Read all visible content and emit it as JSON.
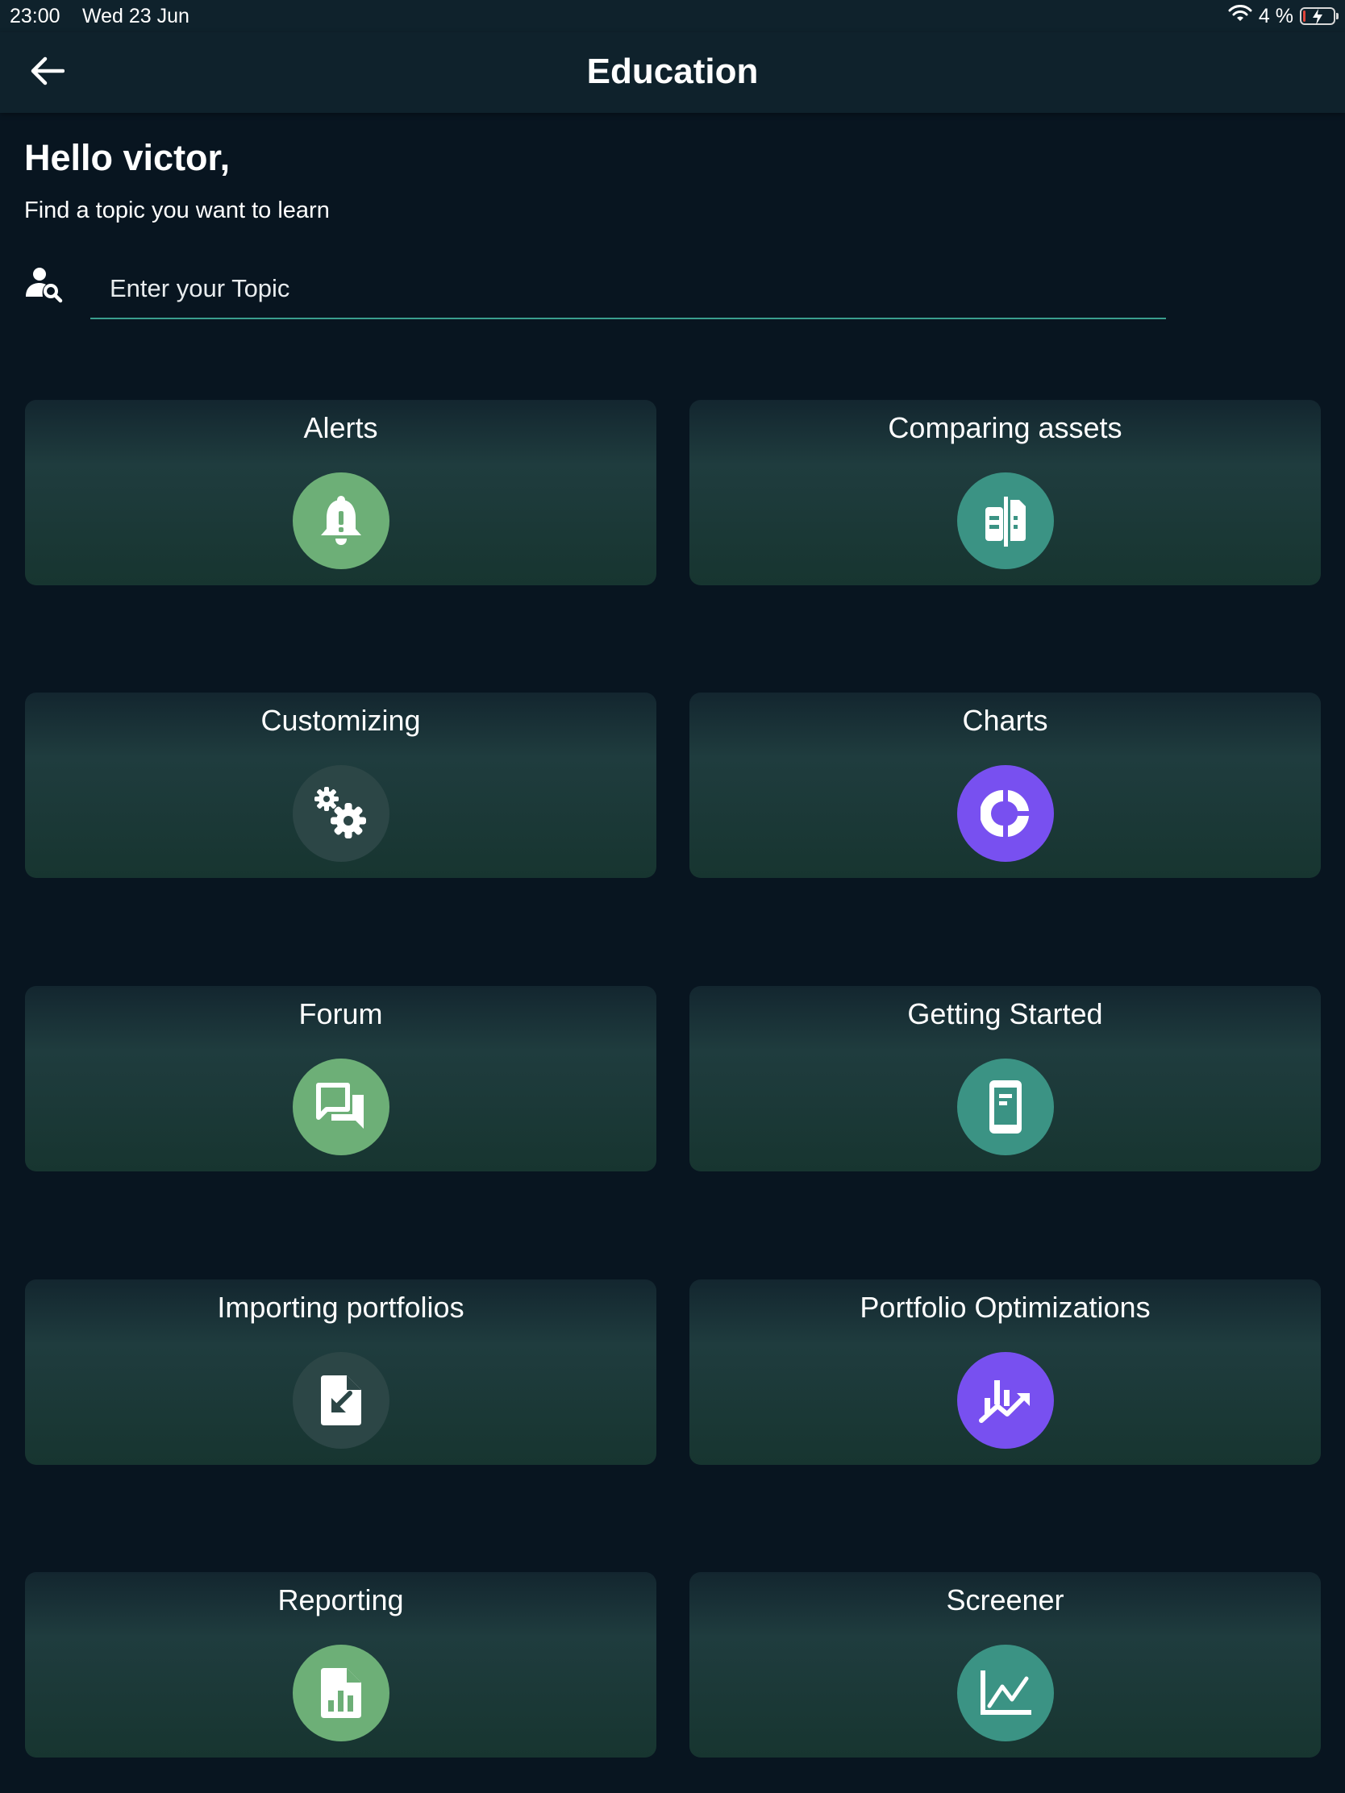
{
  "status_bar": {
    "time": "23:00",
    "date": "Wed 23 Jun",
    "battery_percent": "4 %",
    "icons": [
      "wifi-icon",
      "battery-charging-icon"
    ]
  },
  "app_bar": {
    "title": "Education",
    "back_icon": "arrow-left-icon"
  },
  "greeting": {
    "title": "Hello victor,",
    "subtitle": "Find a topic you want to learn"
  },
  "search": {
    "icon": "person-search-icon",
    "placeholder": "Enter your Topic",
    "value": ""
  },
  "colors": {
    "background": "#081520",
    "app_bar": "#0f222c",
    "accent_line": "#3a9e8e",
    "green": "#6daf77",
    "teal": "#3b9384",
    "purple": "#7850f0",
    "dark_circle": "#2c4646"
  },
  "topics": [
    {
      "label": "Alerts",
      "icon": "bell-alert-icon",
      "color": "#6daf77"
    },
    {
      "label": "Comparing assets",
      "icon": "compare-icon",
      "color": "#3b9384"
    },
    {
      "label": "Customizing",
      "icon": "gears-icon",
      "color": "#2c4646"
    },
    {
      "label": "Charts",
      "icon": "donut-chart-icon",
      "color": "#7850f0"
    },
    {
      "label": "Forum",
      "icon": "forum-icon",
      "color": "#6daf77"
    },
    {
      "label": "Getting Started",
      "icon": "phone-document-icon",
      "color": "#3b9384"
    },
    {
      "label": "Importing portfolios",
      "icon": "file-import-icon",
      "color": "#2c4646"
    },
    {
      "label": "Portfolio Optimizations",
      "icon": "trending-chart-icon",
      "color": "#7850f0"
    },
    {
      "label": "Reporting",
      "icon": "report-icon",
      "color": "#6daf77"
    },
    {
      "label": "Screener",
      "icon": "line-chart-icon",
      "color": "#3b9384"
    }
  ]
}
